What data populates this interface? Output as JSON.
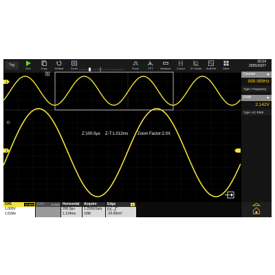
{
  "toolbar": {
    "trig": "Trig",
    "buttons": [
      {
        "label": "Run",
        "icon": "play-icon"
      },
      {
        "label": "Copy",
        "icon": "copy-icon"
      },
      {
        "label": "Default",
        "icon": "default-icon"
      },
      {
        "label": "Zoom",
        "icon": "zoom-icon"
      },
      {
        "label": "Force",
        "icon": "force-icon"
      },
      {
        "label": "FFT",
        "icon": "fft-icon"
      },
      {
        "label": "Measure",
        "icon": "measure-icon"
      },
      {
        "label": "Cursor",
        "icon": "cursor-icon"
      },
      {
        "label": "XY Mode",
        "icon": "xy-mode-icon"
      },
      {
        "label": "AutoSet",
        "icon": "autoset-icon"
      },
      {
        "label": "More",
        "icon": "more-icon"
      }
    ],
    "time": "20:24",
    "date": "2025/10/27"
  },
  "zoom_info": {
    "z_timebase": "Z:100.0μs",
    "z_t": "Z-T:1.012ms",
    "zoom_factor": "Zoom Factor:2.0X"
  },
  "markers": {
    "ch1": "1",
    "trigger_flag": "T"
  },
  "side_panel": {
    "counter_title": "Counter",
    "counter_value": "999.999Hz",
    "counter_type": "Type: Frequency",
    "dvm_title": "DVM",
    "dvm_value": "2.142V",
    "dvm_type": "Type: AC RMS"
  },
  "status": {
    "ch1": {
      "title": "CH1",
      "probe": "10.00X",
      "volts": "1.000V",
      "pos": "1.62div"
    },
    "ch2": {
      "title": "CH2",
      "probe": "10.00X"
    },
    "horizontal": {
      "title": "Horizontal",
      "timebase": "200.0μs",
      "offset": "1.124ms"
    },
    "acquire": {
      "title": "Acquire",
      "rate": "1.250GSa/s",
      "depth": "10M"
    },
    "trigger": {
      "title": "Edge",
      "ch": "1",
      "coupling": "DC",
      "level": "-20.00mV"
    }
  },
  "colors": {
    "ch1": "#f5e23a",
    "accent": "#2f6fd6",
    "grid": "#3a3a3a",
    "panel": "#8c8c8c"
  }
}
